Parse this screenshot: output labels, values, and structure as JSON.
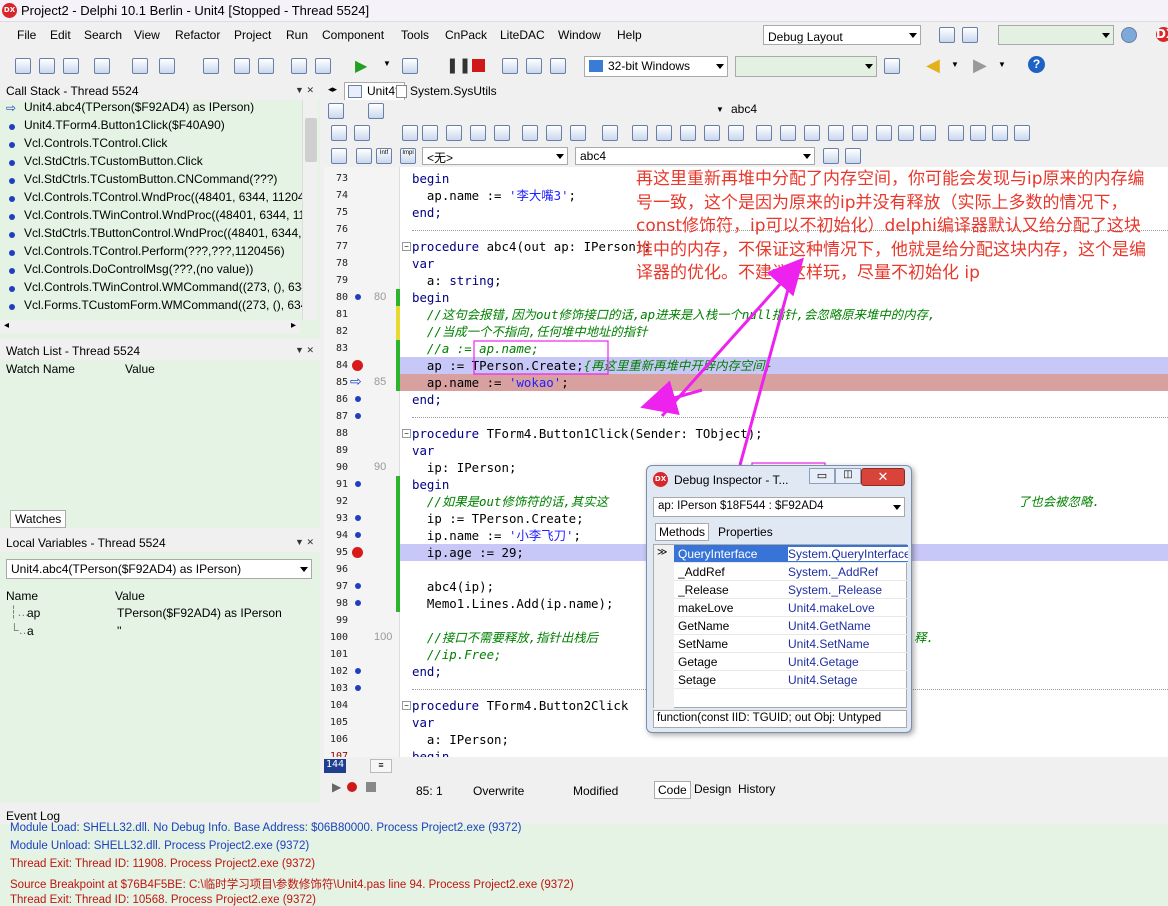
{
  "window": {
    "title": "Project2 - Delphi 10.1 Berlin - Unit4 [Stopped - Thread 5524]"
  },
  "menu": [
    "File",
    "Edit",
    "Search",
    "View",
    "Refactor",
    "Project",
    "Run",
    "Component",
    "Tools",
    "CnPack",
    "LiteDAC",
    "Window",
    "Help"
  ],
  "toolbar": {
    "layout_combo": "Debug Layout",
    "platform_combo": "32-bit Windows",
    "search_value": ""
  },
  "tabs": {
    "editor_tabs": [
      "Unit4*",
      "System.SysUtils"
    ],
    "unit_combo": "abc4",
    "class_combo": "<无>",
    "method_combo": "abc4"
  },
  "call_stack": {
    "title": "Call Stack - Thread 5524",
    "items": [
      "Unit4.abc4(TPerson($F92AD4) as IPerson)",
      "Unit4.TForm4.Button1Click($F40A90)",
      "Vcl.Controls.TControl.Click",
      "Vcl.StdCtrls.TCustomButton.Click",
      "Vcl.StdCtrls.TCustomButton.CNCommand(???)",
      "Vcl.Controls.TControl.WndProc((48401, 6344, 112045",
      "Vcl.Controls.TWinControl.WndProc((48401, 6344, 112",
      "Vcl.StdCtrls.TButtonControl.WndProc((48401, 6344, 1",
      "Vcl.Controls.TControl.Perform(???,???,1120456)",
      "Vcl.Controls.DoControlMsg(???,(no value))",
      "Vcl.Controls.TWinControl.WMCommand((273, (), 634",
      "Vcl.Forms.TCustomForm.WMCommand((273, (), 634"
    ]
  },
  "watch_list": {
    "title": "Watch List - Thread 5524",
    "col_name": "Watch Name",
    "col_value": "Value",
    "tab": "Watches"
  },
  "local_vars": {
    "title": "Local Variables - Thread 5524",
    "frame": "Unit4.abc4(TPerson($F92AD4) as IPerson)",
    "col_name": "Name",
    "col_value": "Value",
    "rows": [
      {
        "name": "ap",
        "value": "TPerson($F92AD4) as IPerson"
      },
      {
        "name": "a",
        "value": "''"
      }
    ]
  },
  "code": {
    "lines": [
      {
        "n": "73",
        "t": "begin"
      },
      {
        "n": "74",
        "t": "  ap.name := '李大嘴3';"
      },
      {
        "n": "75",
        "t": "end;"
      },
      {
        "n": "76",
        "t": ""
      },
      {
        "n": "77",
        "t": "procedure abc4(out ap: IPerson);"
      },
      {
        "n": "78",
        "t": "var"
      },
      {
        "n": "79",
        "t": "  a: string;"
      },
      {
        "n": "80",
        "t": "begin"
      },
      {
        "n": "81",
        "t": "  //这句会报错,因为out修饰接口的话,ap进来是入栈一个null指针,会忽略原来堆中的内存,"
      },
      {
        "n": "82",
        "t": "  //当成一个不指向,任何堆中地址的指针"
      },
      {
        "n": "83",
        "t": "  //a := ap.name;"
      },
      {
        "n": "84",
        "t": "  ap := TPerson.Create;{再这里重新再堆中开辟内存空间}"
      },
      {
        "n": "85",
        "t": "  ap.name := 'wokao';"
      },
      {
        "n": "86",
        "t": "end;"
      },
      {
        "n": "87",
        "t": ""
      },
      {
        "n": "88",
        "t": "procedure TForm4.Button1Click(Sender: TObject);"
      },
      {
        "n": "89",
        "t": "var"
      },
      {
        "n": "90",
        "t": "  ip: IPerson;"
      },
      {
        "n": "91",
        "t": "begin"
      },
      {
        "n": "92",
        "t": "  //如果是out修饰符的话,其实这"
      },
      {
        "n": "93",
        "t": "  ip := TPerson.Create;"
      },
      {
        "n": "94",
        "t": "  ip.name := '小李飞刀';"
      },
      {
        "n": "95",
        "t": "  ip.age := 29;"
      },
      {
        "n": "96",
        "t": ""
      },
      {
        "n": "97",
        "t": "  abc4(ip);"
      },
      {
        "n": "98",
        "t": "  Memo1.Lines.Add(ip.name);"
      },
      {
        "n": "99",
        "t": ""
      },
      {
        "n": "100",
        "t": "  //接口不需要释放,指针出栈后"
      },
      {
        "n": "101",
        "t": "  //ip.Free;"
      },
      {
        "n": "102",
        "t": "end;"
      },
      {
        "n": "103",
        "t": ""
      },
      {
        "n": "104",
        "t": "procedure TForm4.Button2Click"
      },
      {
        "n": "105",
        "t": "var"
      },
      {
        "n": "106",
        "t": "  a: IPerson;"
      },
      {
        "n": "107",
        "t": "begin"
      }
    ],
    "side_numbers": {
      "80": "80",
      "85": "85",
      "90": "90",
      "100": "100"
    },
    "comment_tail_92": "了也会被忽略.",
    "comment_tail_100": "释."
  },
  "annotation": "再这里重新再堆中分配了内存空间，你可能会发现与ip原来的内存编号一致，这个是因为原来的ip并没有释放（实际上多数的情况下，const修饰符，ip可以不初始化）delphi编译器默认又给分配了这块堆中的内存，不保证这种情况下，他就是给分配这块内存，这个是编译器的优化。不建议这样玩，尽量不初始化 ip",
  "inspector": {
    "title": "Debug Inspector - T...",
    "expr": "ap: IPerson $18F544 : $F92AD4",
    "tabs": [
      "Methods",
      "Properties"
    ],
    "rows": [
      {
        "name": "QueryInterface",
        "value": "System.QueryInterface"
      },
      {
        "name": "_AddRef",
        "value": "System._AddRef"
      },
      {
        "name": "_Release",
        "value": "System._Release"
      },
      {
        "name": "makeLove",
        "value": "Unit4.makeLove"
      },
      {
        "name": "GetName",
        "value": "Unit4.GetName"
      },
      {
        "name": "SetName",
        "value": "Unit4.SetName"
      },
      {
        "name": "Getage",
        "value": "Unit4.Getage"
      },
      {
        "name": "Setage",
        "value": "Unit4.Setage"
      }
    ],
    "status": "function(const IID: TGUID; out Obj: Untyped"
  },
  "editor_status": {
    "position": "85:  1",
    "mode": "Overwrite",
    "state": "Modified",
    "tabs": [
      "Code",
      "Design",
      "History"
    ],
    "scroll_value": "144"
  },
  "event_log": {
    "title": "Event Log",
    "lines": [
      {
        "text": "Module Load: SHELL32.dll. No Debug Info. Base Address: $06B80000. Process Project2.exe (9372)",
        "color": "#1f3fbf"
      },
      {
        "text": "Module Unload: SHELL32.dll. Process Project2.exe (9372)",
        "color": "#1f3fbf"
      },
      {
        "text": "Thread Exit: Thread ID: 11908. Process Project2.exe (9372)",
        "color": "#c0150f"
      },
      {
        "text": "Source Breakpoint at $76B4F5BE: C:\\临时学习项目\\参数修饰符\\Unit4.pas line 94. Process Project2.exe (9372)",
        "color": "#c0150f"
      },
      {
        "text": "Thread Exit: Thread ID: 10568. Process Project2.exe (9372)",
        "color": "#c0150f"
      }
    ]
  }
}
